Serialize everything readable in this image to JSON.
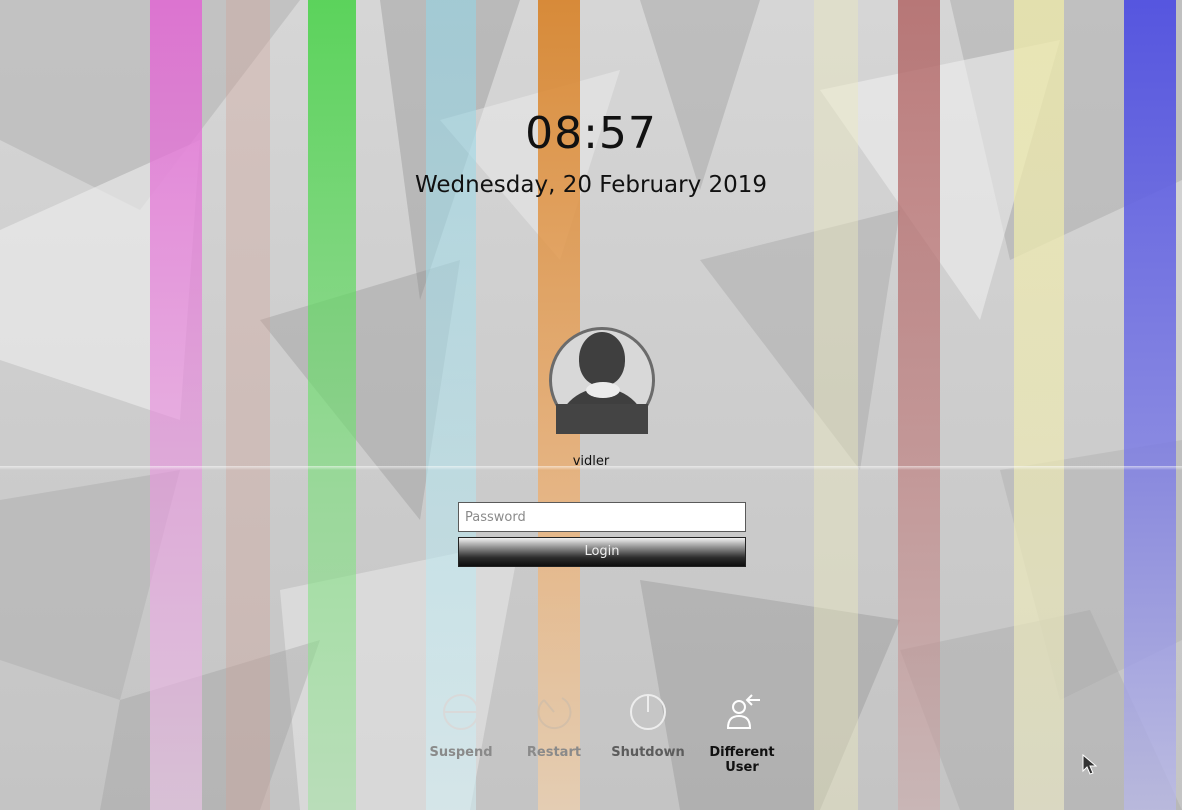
{
  "clock": {
    "time": "08:57",
    "date": "Wednesday, 20 February 2019"
  },
  "user": {
    "name": "vidler",
    "avatar_icon": "user-avatar-icon"
  },
  "password_field": {
    "placeholder": "Password",
    "value": ""
  },
  "login_button": {
    "label": "Login"
  },
  "power_actions": [
    {
      "label": "Suspend",
      "icon": "suspend-icon"
    },
    {
      "label": "Restart",
      "icon": "restart-icon"
    },
    {
      "label": "Shutdown",
      "icon": "shutdown-icon"
    },
    {
      "label": "Different User",
      "icon": "switch-user-icon"
    }
  ],
  "colors": {
    "text_primary": "#111111",
    "button_gradient_dark": "#0e0e0e",
    "stripe_magenta": "#e066d2",
    "stripe_green": "#4fd44f",
    "stripe_cyan": "#a8dce8",
    "stripe_orange": "#ee9a44",
    "stripe_yellow": "#ecebaa",
    "stripe_red": "#b97070",
    "stripe_blue": "#6060e0"
  }
}
